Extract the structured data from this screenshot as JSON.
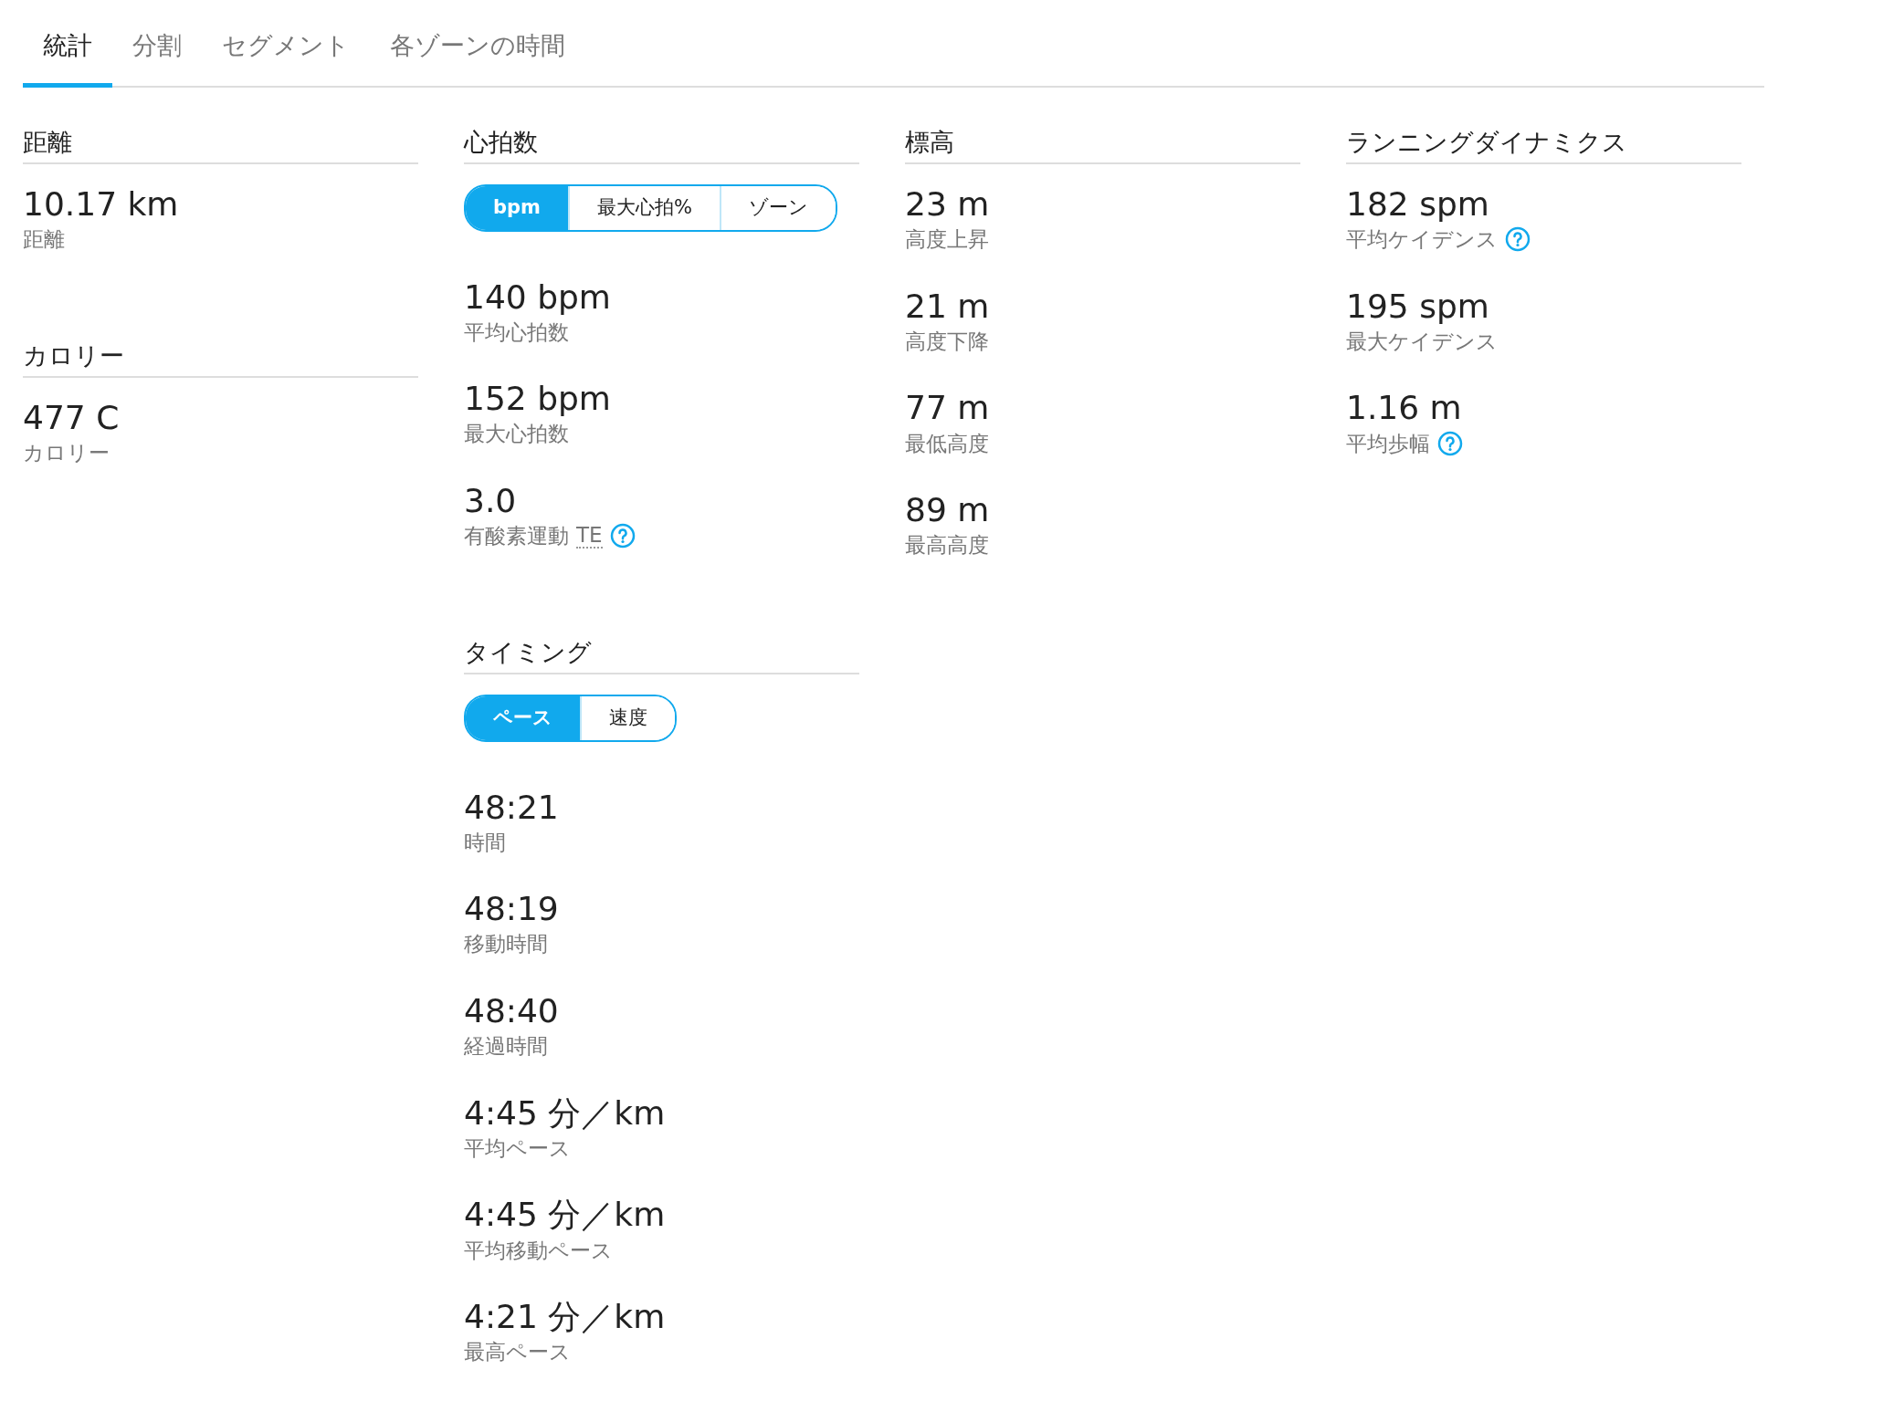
{
  "tabs": [
    {
      "label": "統計",
      "selected": true
    },
    {
      "label": "分割",
      "selected": false
    },
    {
      "label": "セグメント",
      "selected": false
    },
    {
      "label": "各ゾーンの時間",
      "selected": false
    }
  ],
  "columns": [
    {
      "sections": [
        {
          "title": "距離",
          "stats": [
            {
              "value": "10.17 km",
              "label": "距離",
              "help": false
            }
          ]
        },
        {
          "title": "カロリー",
          "stats": [
            {
              "value": "477 C",
              "label": "カロリー",
              "help": false
            }
          ]
        }
      ]
    },
    {
      "sections": [
        {
          "title": "心拍数",
          "toggle": [
            {
              "label": "bpm",
              "selected": true
            },
            {
              "label": "最大心拍%",
              "selected": false
            },
            {
              "label": "ゾーン",
              "selected": false
            }
          ],
          "stats": [
            {
              "value": "140 bpm",
              "label": "平均心拍数",
              "help": false
            },
            {
              "value": "152 bpm",
              "label": "最大心拍数",
              "help": false
            },
            {
              "value": "3.0",
              "label": "有酸素運動",
              "abbreviation": "TE",
              "help": true
            }
          ]
        },
        {
          "title": "タイミング",
          "toggle": [
            {
              "label": "ペース",
              "selected": true
            },
            {
              "label": "速度",
              "selected": false
            }
          ],
          "stats": [
            {
              "value": "48:21",
              "label": "時間",
              "help": false
            },
            {
              "value": "48:19",
              "label": "移動時間",
              "help": false
            },
            {
              "value": "48:40",
              "label": "経過時間",
              "help": false
            },
            {
              "value": "4:45 分／km",
              "label": "平均ペース",
              "help": false
            },
            {
              "value": "4:45 分／km",
              "label": "平均移動ペース",
              "help": false
            },
            {
              "value": "4:21 分／km",
              "label": "最高ペース",
              "help": false
            }
          ]
        }
      ]
    },
    {
      "sections": [
        {
          "title": "標高",
          "stats": [
            {
              "value": "23 m",
              "label": "高度上昇",
              "help": false
            },
            {
              "value": "21 m",
              "label": "高度下降",
              "help": false
            },
            {
              "value": "77 m",
              "label": "最低高度",
              "help": false
            },
            {
              "value": "89 m",
              "label": "最高高度",
              "help": false
            }
          ]
        }
      ]
    },
    {
      "sections": [
        {
          "title": "ランニングダイナミクス",
          "stats": [
            {
              "value": "182 spm",
              "label": "平均ケイデンス",
              "help": true
            },
            {
              "value": "195 spm",
              "label": "最大ケイデンス",
              "help": false
            },
            {
              "value": "1.16 m",
              "label": "平均歩幅",
              "help": true
            }
          ]
        }
      ]
    }
  ]
}
